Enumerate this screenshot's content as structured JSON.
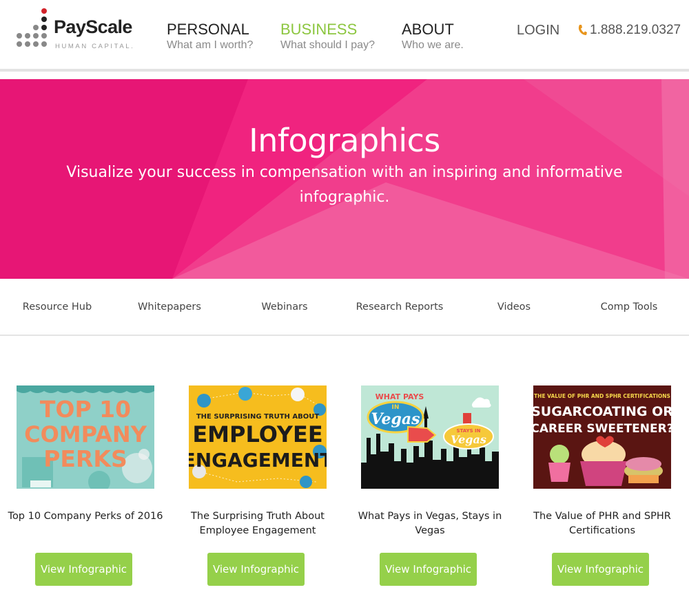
{
  "brand": {
    "name": "PayScale",
    "tagline": "HUMAN CAPITAL."
  },
  "nav": {
    "items": [
      {
        "title": "PERSONAL",
        "subtitle": "What am I worth?"
      },
      {
        "title": "BUSINESS",
        "subtitle": "What should I pay?"
      },
      {
        "title": "ABOUT",
        "subtitle": "Who we are."
      }
    ],
    "login": "LOGIN",
    "phone": "1.888.219.0327"
  },
  "hero": {
    "title": "Infographics",
    "subtitle": "Visualize your success in compensation with an inspiring and informative infographic."
  },
  "subnav": [
    "Resource Hub",
    "Whitepapers",
    "Webinars",
    "Research Reports",
    "Videos",
    "Comp Tools"
  ],
  "cards": [
    {
      "title": "Top 10 Company Perks of 2016",
      "button": "View Infographic",
      "art": {
        "line1": "TOP 10",
        "line2": "COMPANY",
        "line3": "PERKS"
      }
    },
    {
      "title": "The Surprising Truth About Employee Engagement",
      "button": "View Infographic",
      "art": {
        "line1": "THE SURPRISING TRUTH ABOUT",
        "line2": "EMPLOYEE",
        "line3": "ENGAGEMENT"
      }
    },
    {
      "title": "What Pays in Vegas, Stays in Vegas",
      "button": "View Infographic",
      "art": {
        "sign_top": "WHAT PAYS",
        "sign_in": "IN",
        "sign_main": "Vegas",
        "sign2_top": "STAYS IN",
        "sign2_main": "Vegas"
      }
    },
    {
      "title": "The Value of PHR and SPHR Certifications",
      "button": "View Infographic",
      "art": {
        "line1": "THE VALUE OF PHR AND SPHR CERTIFICATIONS",
        "line2": "SUGARCOATING OR",
        "line3": "CAREER SWEETENER?"
      }
    }
  ],
  "colors": {
    "accent_green": "#8cc63f",
    "button_green": "#95d04a",
    "hero_pink": "#ef1d7c",
    "logo_red": "#d2232a"
  },
  "icons": {
    "phone": "phone-icon"
  }
}
